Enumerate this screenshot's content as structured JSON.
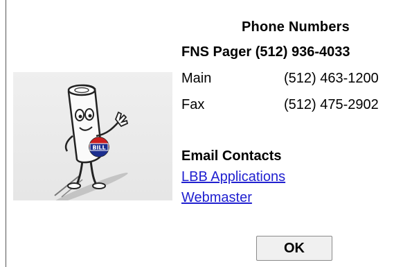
{
  "phone": {
    "title": "Phone Numbers",
    "pager": "FNS Pager (512) 936-4033",
    "rows": [
      {
        "label": "Main",
        "number": "(512) 463-1200"
      },
      {
        "label": "Fax",
        "number": "(512) 475-2902"
      }
    ]
  },
  "email": {
    "title": "Email Contacts",
    "links": [
      "LBB Applications",
      "Webmaster"
    ]
  },
  "illustration": {
    "badge_text": "BILL"
  },
  "buttons": {
    "ok_label": "OK"
  }
}
